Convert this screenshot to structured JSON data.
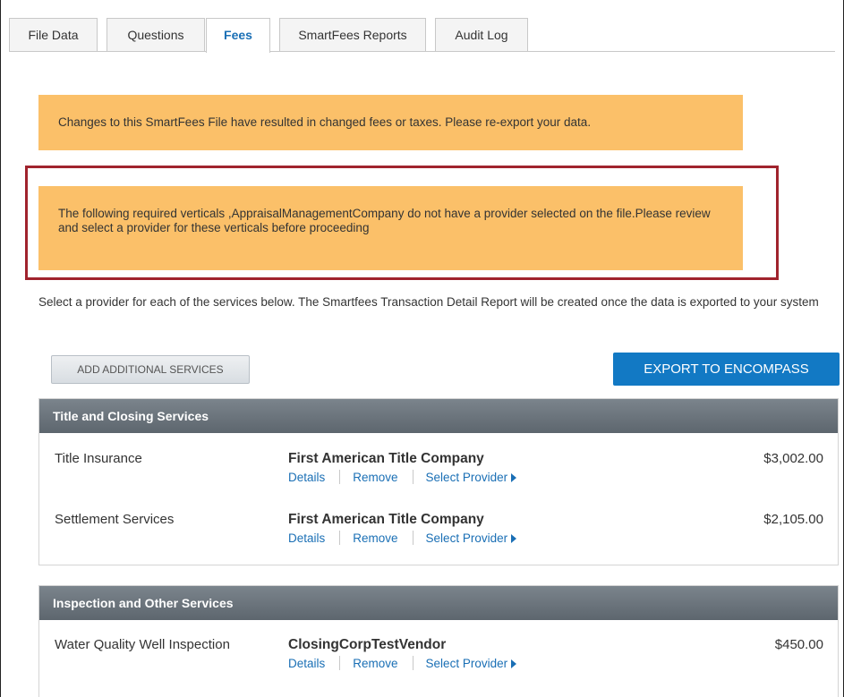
{
  "tabs": [
    {
      "label": "File Data",
      "active": false
    },
    {
      "label": "Questions",
      "active": false
    },
    {
      "label": "Fees",
      "active": true
    },
    {
      "label": "SmartFees Reports",
      "active": false
    },
    {
      "label": "Audit Log",
      "active": false
    }
  ],
  "alerts": {
    "changed_fees": "Changes to this SmartFees File have resulted in changed fees or taxes. Please re-export your data.",
    "required_verticals": "The following required verticals ,AppraisalManagementCompany do not have a provider selected on the file.Please review and select a provider for these verticals before proceeding"
  },
  "instructions": "Select a provider for each of the services below. The Smartfees Transaction Detail Report will be created once the data is exported to your system",
  "buttons": {
    "add_services": "ADD ADDITIONAL SERVICES",
    "export": "EXPORT TO ENCOMPASS"
  },
  "link_labels": {
    "details": "Details",
    "remove": "Remove",
    "select_provider": "Select Provider"
  },
  "sections": [
    {
      "title": "Title and Closing Services",
      "rows": [
        {
          "service": "Title Insurance",
          "provider": "First American Title Company",
          "price": "$3,002.00"
        },
        {
          "service": "Settlement Services",
          "provider": "First American Title Company",
          "price": "$2,105.00"
        }
      ]
    },
    {
      "title": "Inspection and Other Services",
      "rows": [
        {
          "service": "Water Quality Well Inspection",
          "provider": "ClosingCorpTestVendor",
          "price": "$450.00"
        }
      ]
    }
  ],
  "colors": {
    "alert_bg": "#fbc069",
    "highlight_border": "#a0232d",
    "accent_blue": "#1279c4",
    "link_blue": "#1a6fb5"
  }
}
